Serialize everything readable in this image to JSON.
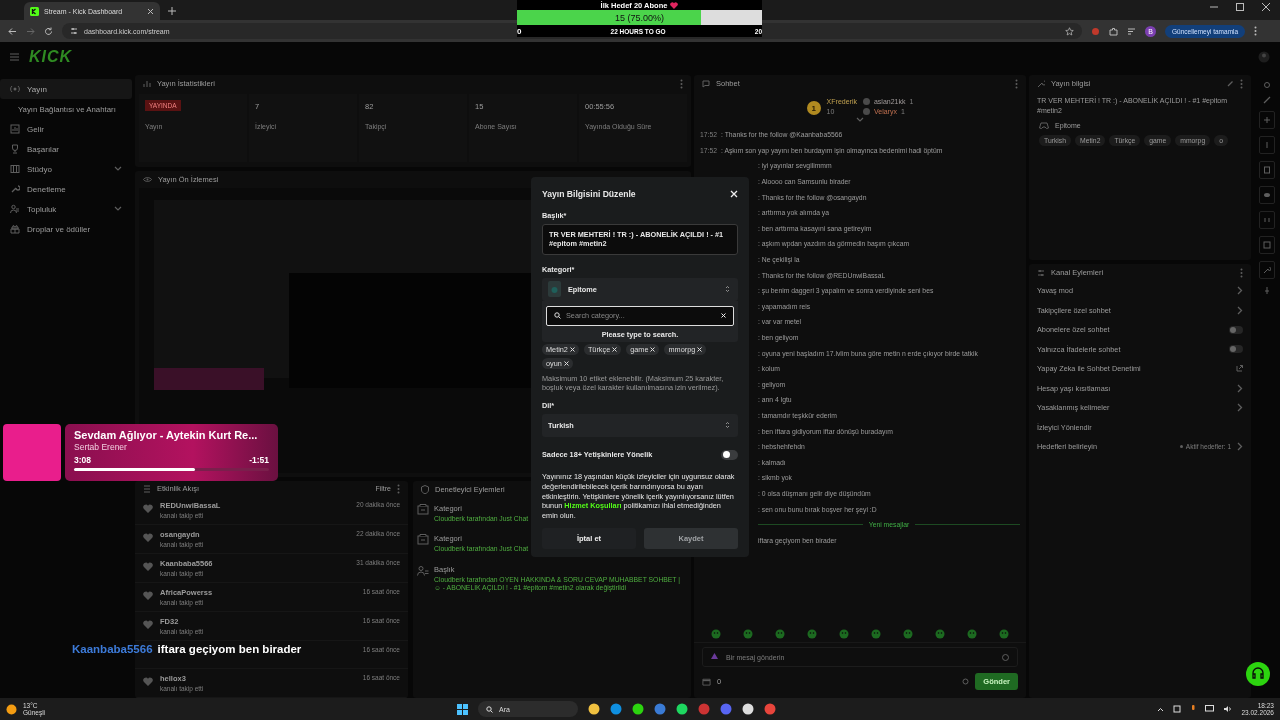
{
  "browser": {
    "tab_title": "Stream - Kick Dashboard",
    "url": "dashboard.kick.com/stream",
    "profile_initial": "B",
    "update_button": "Güncellemeyi tamamla"
  },
  "goal_widget": {
    "title": "İlk Hedef 20 Abone",
    "progress_text": "15 (75.00%)",
    "level": 0.75,
    "start": "0",
    "remaining": "22 HOURS TO GO",
    "target": "20"
  },
  "header": {
    "logo": "KICK"
  },
  "sidebar": {
    "items": [
      {
        "label": "Yayın",
        "kind": "section"
      },
      {
        "label": "Yayın Bağlantısı ve Anahtarı",
        "kind": "subitem"
      },
      {
        "label": "Gelir",
        "kind": "item"
      },
      {
        "label": "Başarılar",
        "kind": "item"
      },
      {
        "label": "Stüdyo",
        "kind": "group",
        "expanded": false
      },
      {
        "label": "Denetleme",
        "kind": "item"
      },
      {
        "label": "Topluluk",
        "kind": "group",
        "expanded": false
      },
      {
        "label": "Droplar ve ödüller",
        "kind": "item"
      }
    ]
  },
  "stats": {
    "title": "Yayın İstatistikleri",
    "cells": [
      {
        "kind": "badge",
        "value": "YAYINDA",
        "label": "Yayın"
      },
      {
        "kind": "number",
        "value": "7",
        "label": "İzleyici"
      },
      {
        "kind": "number",
        "value": "82",
        "label": "Takipçi"
      },
      {
        "kind": "number",
        "value": "15",
        "label": "Abone Sayısı"
      },
      {
        "kind": "number",
        "value": "00:55:56",
        "label": "Yayında Olduğu Süre"
      }
    ]
  },
  "preview": {
    "title": "Yayın Ön İzlemesi"
  },
  "activity": {
    "title": "Etkinlik Akışı",
    "filter": "Filtre",
    "events": [
      {
        "name": "REDUnwiBassaL",
        "action": "kanalı takip etti",
        "time": "20 dakika önce"
      },
      {
        "name": "osangaydn",
        "action": "kanalı takip etti",
        "time": "22 dakika önce"
      },
      {
        "name": "Kaanbaba5566",
        "action": "kanalı takip etti",
        "time": "31 dakika önce"
      },
      {
        "name": "AfricaPowerss",
        "action": "kanalı takip etti",
        "time": "16 saat önce"
      },
      {
        "name": "FD32",
        "action": "kanalı takip etti",
        "time": "16 saat önce"
      },
      {
        "time": "16 saat önce"
      },
      {
        "name": "hellox3",
        "action": "kanalı takip etti",
        "time": "16 saat önce"
      }
    ]
  },
  "moderator_log": {
    "title": "Denetleyici Eylemleri",
    "entries": [
      {
        "kind": "category",
        "title": "Kategori",
        "text": "Cloudberk tarafından Just Chat"
      },
      {
        "kind": "category",
        "title": "Kategori",
        "text": "Cloudberk tarafından Just Chat"
      },
      {
        "kind": "title",
        "title": "Başlık",
        "text": "Cloudberk tarafından OYEN HAKKINDA & SORU CEVAP MUHABBET SOHBET | ☺ - ABONELİK AÇILDI ! - #1 #epitom #metin2 olarak değiştirildi"
      }
    ]
  },
  "chat": {
    "title": "Sohbet",
    "leaderboard": [
      {
        "rank": "1",
        "name": "XFrederik",
        "count": "10"
      },
      {
        "name": "aslan21kk",
        "count": "1"
      },
      {
        "name": "Velaryx",
        "count": "1"
      }
    ],
    "messages": [
      {
        "kind": "full",
        "time": "17:52",
        "text": ": Thanks for the follow @Kaanbaba5566"
      },
      {
        "kind": "full",
        "time": "17:52",
        "text": ": Aşkım son yap yayını ben burdayım işin olmayınca bedenimi hadi öptüm"
      },
      {
        "kind": "cut",
        "text": ": iyi yayınlar sevgilimmm"
      },
      {
        "kind": "cut",
        "text": ": Aloooo can Samsunlu birader"
      },
      {
        "kind": "cut",
        "text": ": Thanks for the follow @osangaydn"
      },
      {
        "kind": "cut",
        "text": ": arttırma yok alımda ya"
      },
      {
        "kind": "cut",
        "text": ": ben arttırma kasayıni sana getireyim"
      },
      {
        "kind": "cut",
        "text": ": aşkım wpdan yazdım da görmedin başım çıkcam"
      },
      {
        "kind": "cut",
        "text": ": Ne çekilişi la"
      },
      {
        "kind": "cut",
        "text": ": Thanks for the follow @REDUnwiBassaL"
      },
      {
        "kind": "cut",
        "text": ": şu benim daggeri 3 yapalım ve sonra verdiyinde seni bes"
      },
      {
        "kind": "cut",
        "text": ": yapamadım reis"
      },
      {
        "kind": "cut",
        "text": ": var var metel"
      },
      {
        "kind": "cut",
        "text": ": ben geliyom"
      },
      {
        "kind": "cut",
        "text": ": oyuna yeni başladım 17.lvlim buna göre metin n erde çıkıyor birde tatkik"
      },
      {
        "kind": "cut",
        "text": ": kolum"
      },
      {
        "kind": "cut",
        "text": ": geliyom"
      },
      {
        "kind": "cut",
        "text": ": ann 4 lgtu"
      },
      {
        "kind": "cut",
        "text": ": tamamdır teşkkür ederim"
      },
      {
        "kind": "cut",
        "text": ": ben iftara gidiyorum iftar dönüşü buradayım"
      },
      {
        "kind": "cut",
        "text": ": hebshehfehdn"
      },
      {
        "kind": "cut",
        "text": ": kalmadı"
      },
      {
        "kind": "cut",
        "text": ": sikmb yok"
      },
      {
        "kind": "cut",
        "text": ": 0 olsa düşmanı gelir diye düşündüm"
      },
      {
        "kind": "cut",
        "text": ": sen onu bunu bırak boşver her şeyi :D"
      },
      {
        "kind": "divider",
        "text": "Yeni mesajlar"
      },
      {
        "kind": "cut",
        "text": "iftara geçiyom ben birader"
      }
    ],
    "input_placeholder": "Bir mesaj gönderin",
    "count": "0",
    "send_button": "Gönder"
  },
  "stream_info": {
    "title": "Yayın bilgisi",
    "stream_title": "TR VER MEHTERİ ! TR :) - ABONELİK AÇILDI ! - #1 #epitom #metin2",
    "category": "Epitome",
    "tags": [
      "Turkish",
      "Metin2",
      "Türkçe",
      "game",
      "mmorpg",
      "o"
    ]
  },
  "channel_actions": {
    "title": "Kanal Eylemleri",
    "items": [
      {
        "kind": "link",
        "label": "Yavaş mod"
      },
      {
        "kind": "link",
        "label": "Takipçilere özel sohbet"
      },
      {
        "kind": "toggle",
        "label": "Abonelere özel sohbet",
        "on": false
      },
      {
        "kind": "toggle",
        "label": "Yalnızca İfadelerle sohbet",
        "on": false
      },
      {
        "kind": "external",
        "label": "Yapay Zeka ile Sohbet Denetimi"
      },
      {
        "kind": "link",
        "label": "Hesap yaşı kısıtlaması"
      },
      {
        "kind": "link",
        "label": "Yasaklanmış kelimeler"
      },
      {
        "kind": "plain",
        "label": "İzleyici Yönlendir"
      },
      {
        "kind": "link",
        "label": "Hedefleri belirleyin",
        "note": "Aktif hedefler: 1"
      }
    ]
  },
  "modal": {
    "title": "Yayın Bilgisini Düzenle",
    "title_label": "Başlık*",
    "title_value": "TR VER MEHTERİ ! TR :)  - ABONELİK AÇILDI ! - #1 #epitom #metin2",
    "category_label": "Kategori*",
    "category": "Epitome",
    "search_placeholder": "Search category...",
    "search_hint": "Please type to search.",
    "tags": [
      "Metin2",
      "Türkçe",
      "game",
      "mmorpg",
      "oyun"
    ],
    "tags_note": "Maksimum 10 etiket eklenebilir. (Maksimum 25 karakter, boşluk veya özel karakter kullanılmasına izin verilmez).",
    "language_label": "Dil*",
    "language": "Turkish",
    "mature": {
      "label": "Sadece 18+ Yetişkinlere Yönelik",
      "on": false
    },
    "notice_before": "Yayınınız 18 yaşından küçük izleyiciler için uygunsuz olarak değerlendirilebilecek içerik barındırıyorsa bu ayarı etkinleştirin. Yetişkinlere yönelik içerik yayınlıyorsanız lütfen bunun ",
    "notice_link": "Hizmet Koşulları",
    "notice_after": " politikamızı ihlal etmediğinden emin olun.",
    "buttons": [
      {
        "kind": "cancel",
        "label": "İptal et",
        "disabled": false
      },
      {
        "kind": "save",
        "label": "Kaydet",
        "disabled": true
      }
    ]
  },
  "music_widget": {
    "title": "Sevdam Ağlıyor - Aytekin Kurt Re...",
    "artist": "Sertab Erener",
    "elapsed": "3:08",
    "remaining": "-1:51",
    "level": 0.62
  },
  "chat_overlay": {
    "user": "Kaanbaba5566",
    "message": "iftara geçiyom ben birader"
  },
  "taskbar": {
    "temperature": "13°C",
    "weather": "Güneşli",
    "search": "Ara",
    "time": "18:23",
    "date": "23.02.2026"
  }
}
